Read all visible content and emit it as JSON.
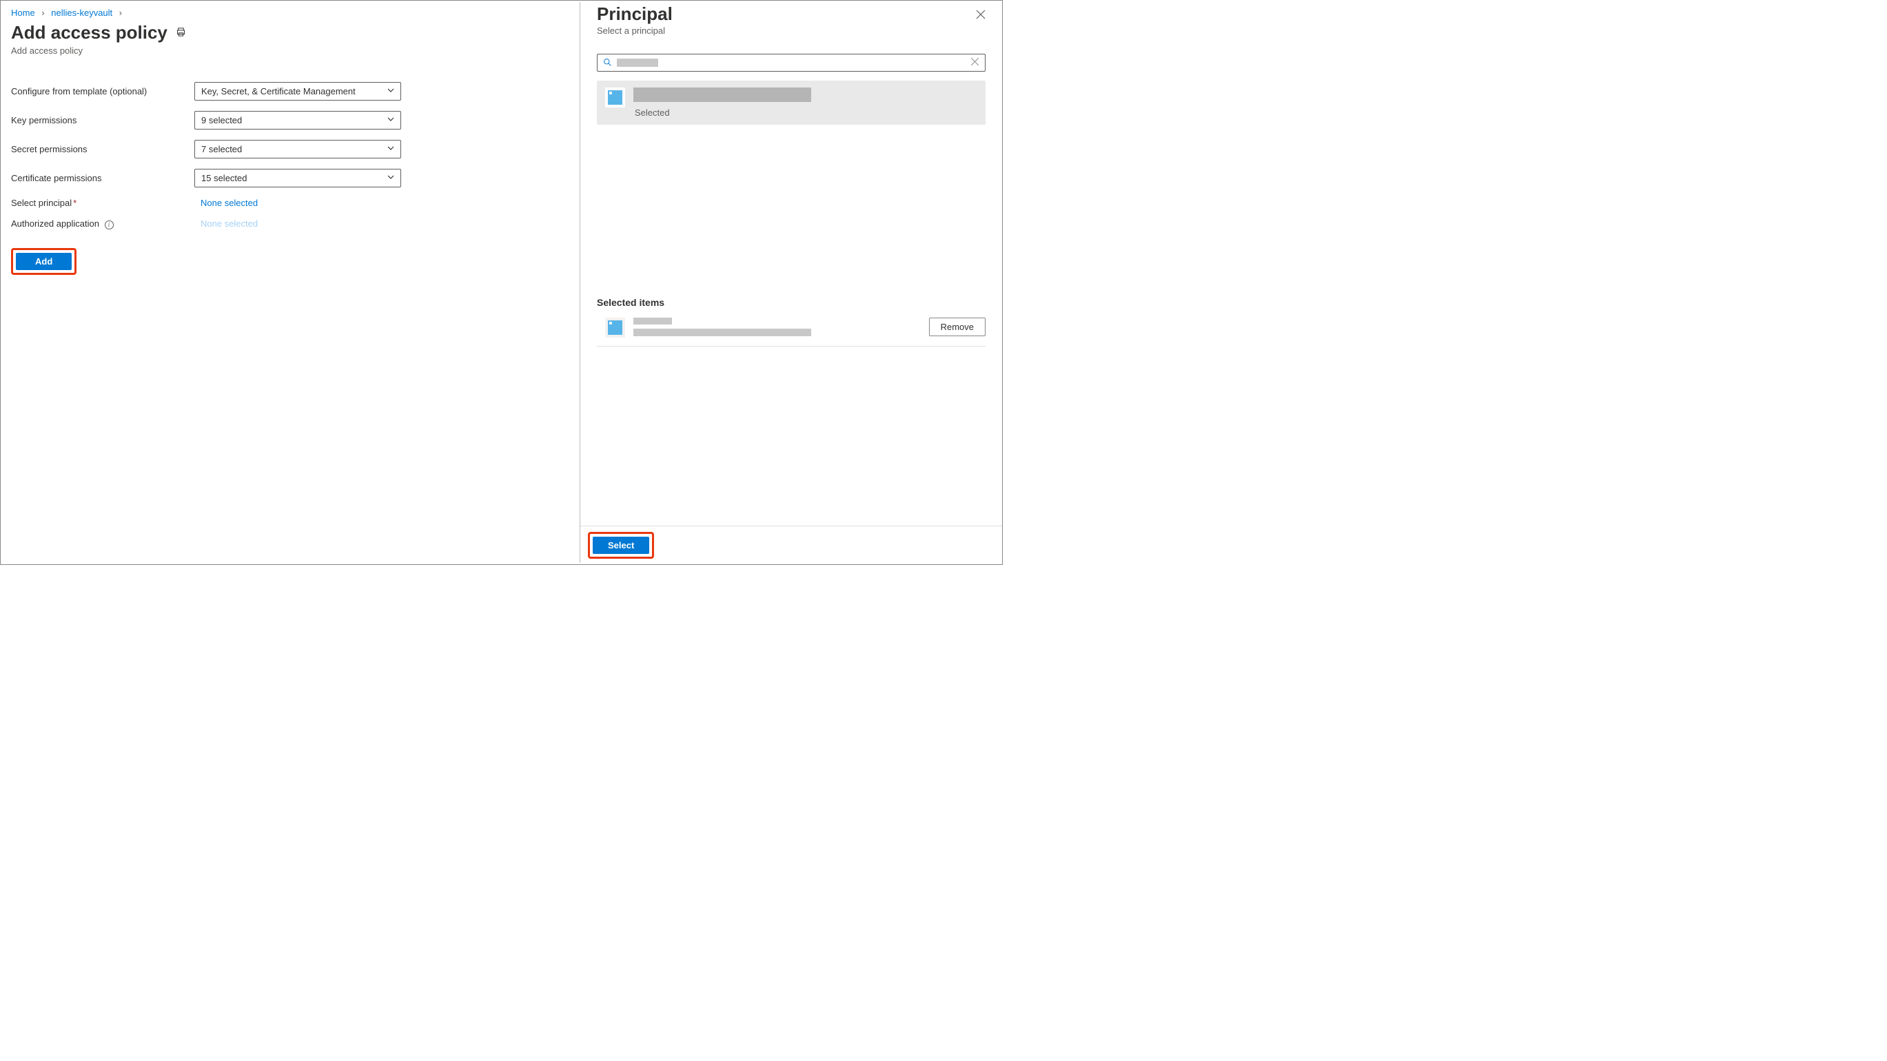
{
  "breadcrumb": {
    "home": "Home",
    "vault": "nellies-keyvault"
  },
  "page": {
    "title": "Add access policy",
    "subtitle": "Add access policy"
  },
  "form": {
    "template_label": "Configure from template (optional)",
    "template_value": "Key, Secret, & Certificate Management",
    "key_perm_label": "Key permissions",
    "key_perm_value": "9 selected",
    "secret_perm_label": "Secret permissions",
    "secret_perm_value": "7 selected",
    "cert_perm_label": "Certificate permissions",
    "cert_perm_value": "15 selected",
    "principal_label": "Select principal",
    "principal_value": "None selected",
    "app_label": "Authorized application",
    "app_value": "None selected",
    "add_btn": "Add"
  },
  "panel": {
    "title": "Principal",
    "subtitle": "Select a principal",
    "result_selected_text": "Selected",
    "selected_heading": "Selected items",
    "remove_btn": "Remove",
    "select_btn": "Select"
  }
}
